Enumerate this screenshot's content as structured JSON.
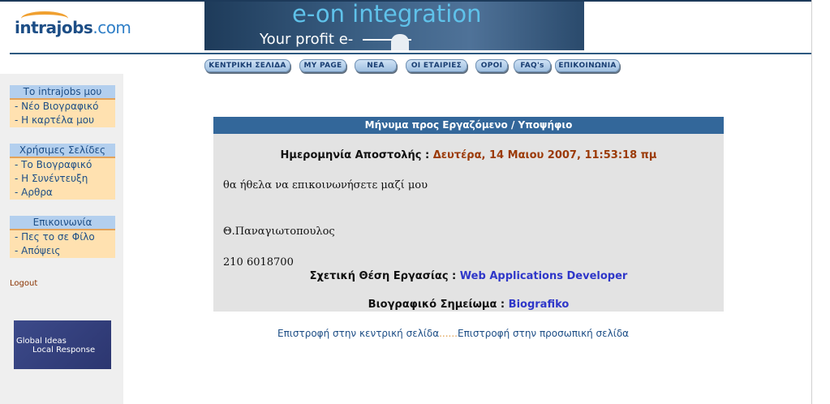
{
  "header": {
    "logo_text": "intrajobs",
    "logo_suffix": ".com",
    "banner_line1": "e-on integration",
    "banner_line2": "Your profit e-"
  },
  "nav": {
    "items": [
      {
        "label": "ΚΕΝΤΡΙΚΗ ΣΕΛΙΔΑ"
      },
      {
        "label": "MY PAGE"
      },
      {
        "label": "ΝΕΑ"
      },
      {
        "label": "ΟΙ ΕΤΑΙΡΙΕΣ"
      },
      {
        "label": "ΟΡΟΙ"
      },
      {
        "label": "FAQ's"
      },
      {
        "label": "ΕΠΙΚΟΙΝΩΝΙΑ"
      }
    ]
  },
  "sidebar": {
    "groups": [
      {
        "title": "Το intrajobs μου",
        "items": [
          "- Νέο Βιογραφικό",
          "- Η καρτέλα μου"
        ]
      },
      {
        "title": "Χρήσιμες Σελίδες",
        "items": [
          "- Το Βιογραφικό",
          "- Η Συνέντευξη",
          "- Αρθρα"
        ]
      },
      {
        "title": "Επικοινωνία",
        "items": [
          "- Πες το σε Φίλο",
          "- Απόψεις"
        ]
      }
    ],
    "logout": "Logout",
    "ad": {
      "line1": "Global Ideas",
      "line2": "Local Response"
    }
  },
  "message": {
    "title": "Μήνυμα προς Εργαζόμενο / Υποψήφιο",
    "date_label": "Ημερομηνία Αποστολής :",
    "date_value": "Δευτέρα, 14 Μαιου 2007, 11:53:18 πμ",
    "body_line1": "θα ήθελα να επικοινωνήσετε μαζί μου",
    "body_line2": "Θ.Παναγιωτοπουλος",
    "body_line3": "210 6018700",
    "position_label": "Σχετική Θέση Εργασίας :",
    "position_value": "Web Applications Developer",
    "cv_label": "Βιογραφικό Σημείωμα :",
    "cv_value": "Biografiko"
  },
  "footer_links": {
    "back_home": "Επιστροφή στην κεντρική σελίδα",
    "separator": "......",
    "back_personal": "Επιστροφή στην προσωπική σελίδα"
  },
  "colors": {
    "accent_blue": "#33679a",
    "date_value": "#9b3a07",
    "link_blue": "#2f37c9",
    "sidebar_bg": "#efefef",
    "sidebar_item": "#ffe1b0"
  }
}
